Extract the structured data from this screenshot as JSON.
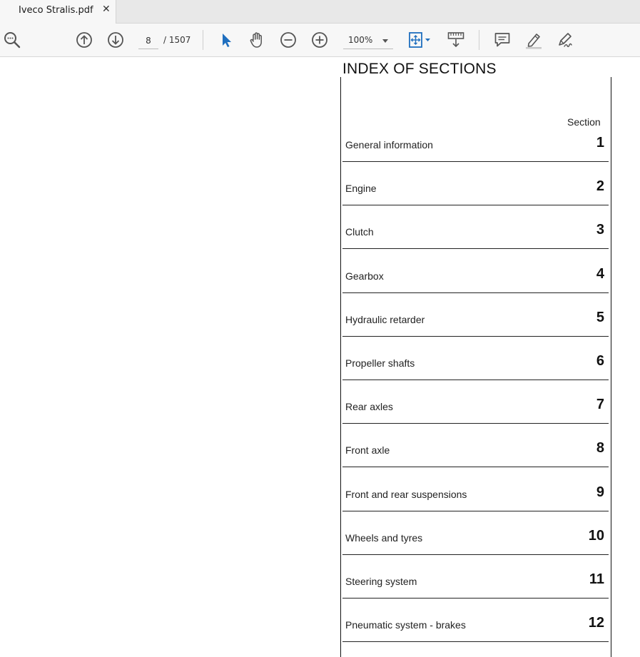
{
  "tab": {
    "title": "Iveco Stralis.pdf",
    "close_glyph": "✕"
  },
  "toolbar": {
    "page_current": "8",
    "page_total": "/ 1507",
    "zoom_value": "100%",
    "icons": {
      "find": "search-zoom-icon",
      "prev_page": "arrow-up-circle-icon",
      "next_page": "arrow-down-circle-icon",
      "select": "pointer-icon",
      "hand": "hand-icon",
      "zoom_out": "minus-circle-icon",
      "zoom_in": "plus-circle-icon",
      "fit": "fit-page-icon",
      "read_mode": "read-mode-icon",
      "comment": "comment-icon",
      "highlight": "highlight-pen-icon",
      "sign": "sign-icon"
    },
    "accent_color": "#1f6fbf"
  },
  "document": {
    "heading": "INDEX OF SECTIONS",
    "column_label": "Section",
    "sections": [
      {
        "name": "General information",
        "number": "1"
      },
      {
        "name": "Engine",
        "number": "2"
      },
      {
        "name": "Clutch",
        "number": "3"
      },
      {
        "name": "Gearbox",
        "number": "4"
      },
      {
        "name": "Hydraulic retarder",
        "number": "5"
      },
      {
        "name": "Propeller shafts",
        "number": "6"
      },
      {
        "name": "Rear axles",
        "number": "7"
      },
      {
        "name": "Front axle",
        "number": "8"
      },
      {
        "name": "Front and rear suspensions",
        "number": "9"
      },
      {
        "name": "Wheels and tyres",
        "number": "10"
      },
      {
        "name": "Steering system",
        "number": "11"
      },
      {
        "name": "Pneumatic system - brakes",
        "number": "12"
      }
    ]
  }
}
